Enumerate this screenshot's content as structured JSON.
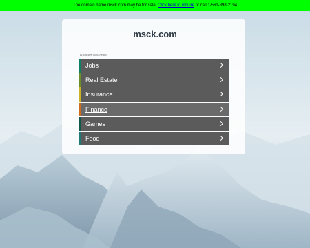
{
  "banner": {
    "text_before": "The domain name msck.com may be for sale. ",
    "link_text": "Click here to inquire",
    "text_after": " or call 1-561-898-2194"
  },
  "site": {
    "title": "msck.com"
  },
  "related": {
    "heading": "Related searches",
    "items": [
      {
        "label": "Jobs",
        "accent": "#0f7f65"
      },
      {
        "label": "Real Estate",
        "accent": "#6a8f2a"
      },
      {
        "label": "Insurance",
        "accent": "#c9b325"
      },
      {
        "label": "Finance",
        "accent": "#d06a1c",
        "highlighted": true
      },
      {
        "label": "Games",
        "accent": "#10564a"
      },
      {
        "label": "Food",
        "accent": "#1e7a78"
      }
    ]
  }
}
